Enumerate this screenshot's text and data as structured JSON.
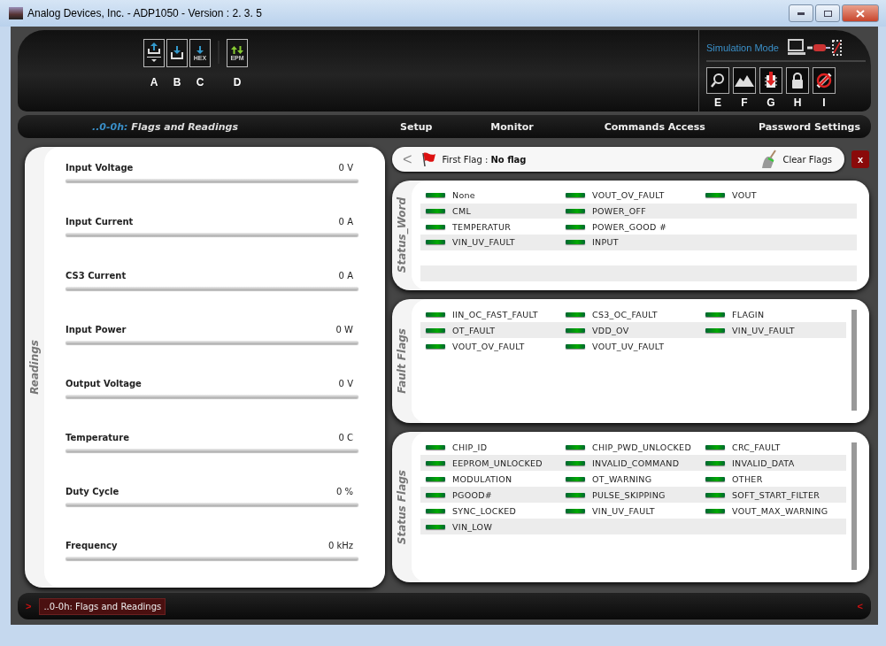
{
  "window": {
    "title": "Analog Devices, Inc. - ADP1050 - Version :  2. 3. 5"
  },
  "toolbar": [
    {
      "kind": "upload-menu",
      "letter": "A"
    },
    {
      "kind": "download",
      "letter": "B"
    },
    {
      "kind": "hex",
      "text": "HEX",
      "letter": "C"
    },
    {
      "kind": "epm",
      "text": "EPM",
      "letter": "D"
    }
  ],
  "mode": {
    "label": "Simulation Mode"
  },
  "tools": [
    {
      "kind": "search",
      "letter": "E"
    },
    {
      "kind": "chart",
      "letter": "F"
    },
    {
      "kind": "chip-download",
      "letter": "G"
    },
    {
      "kind": "lock",
      "letter": "H"
    },
    {
      "kind": "disconnect",
      "letter": "I"
    }
  ],
  "breadcrumb": {
    "prefix": "..0-0h:",
    "title": "Flags and Readings"
  },
  "tabs": [
    {
      "label": "Setup",
      "selected": false
    },
    {
      "label": "Monitor",
      "selected": false
    },
    {
      "label": "Commands Access",
      "selected": false
    },
    {
      "label": "Password Settings",
      "selected": false
    }
  ],
  "readings": {
    "title": "Readings",
    "items": [
      {
        "name": "Input Voltage",
        "reading": "0 V",
        "level": 0
      },
      {
        "name": "Input Current",
        "reading": "0 A",
        "level": 0
      },
      {
        "name": "CS3 Current",
        "reading": "0 A",
        "level": 0
      },
      {
        "name": "Input Power",
        "reading": "0 W",
        "level": 0
      },
      {
        "name": "Output Voltage",
        "reading": "0 V",
        "level": 0
      },
      {
        "name": "Temperature",
        "reading": "0 C",
        "level": 0
      },
      {
        "name": "Duty Cycle",
        "reading": "0 %",
        "level": 0
      },
      {
        "name": "Frequency",
        "reading": "0 kHz",
        "level": 0
      }
    ]
  },
  "first_flag": {
    "back": "<",
    "label": "First Flag :",
    "value": "No flag",
    "clear": "Clear Flags",
    "close": "x"
  },
  "panels": [
    {
      "title": "Status_Word",
      "scroll": false,
      "rows": [
        [
          {
            "name": "None",
            "on": false
          },
          {
            "name": "VOUT_OV_FAULT",
            "on": false
          },
          {
            "name": "VOUT",
            "on": false
          }
        ],
        [
          {
            "name": "CML",
            "on": false
          },
          {
            "name": "POWER_OFF",
            "on": false
          }
        ],
        [
          {
            "name": "TEMPERATUR",
            "on": false
          },
          {
            "name": "POWER_GOOD #",
            "on": false
          }
        ],
        [
          {
            "name": "VIN_UV_FAULT",
            "on": false
          },
          {
            "name": "INPUT",
            "on": false
          }
        ]
      ]
    },
    {
      "title": "Fault Flags",
      "scroll": true,
      "rows": [
        [
          {
            "name": "IIN_OC_FAST_FAULT",
            "on": false
          },
          {
            "name": "CS3_OC_FAULT",
            "on": false
          },
          {
            "name": "FLAGIN",
            "on": false
          }
        ],
        [
          {
            "name": "OT_FAULT",
            "on": false
          },
          {
            "name": "VDD_OV",
            "on": false
          },
          {
            "name": "VIN_UV_FAULT",
            "on": false
          }
        ],
        [
          {
            "name": "VOUT_OV_FAULT",
            "on": false
          },
          {
            "name": "VOUT_UV_FAULT",
            "on": false
          }
        ]
      ]
    },
    {
      "title": "Status Flags",
      "scroll": true,
      "rows": [
        [
          {
            "name": "CHIP_ID",
            "on": false
          },
          {
            "name": "CHIP_PWD_UNLOCKED",
            "on": false
          },
          {
            "name": "CRC_FAULT",
            "on": false
          }
        ],
        [
          {
            "name": "EEPROM_UNLOCKED",
            "on": false
          },
          {
            "name": "INVALID_COMMAND",
            "on": false
          },
          {
            "name": "INVALID_DATA",
            "on": false
          }
        ],
        [
          {
            "name": "MODULATION",
            "on": false
          },
          {
            "name": "OT_WARNING",
            "on": false
          },
          {
            "name": "OTHER",
            "on": false
          }
        ],
        [
          {
            "name": "PGOOD#",
            "on": false
          },
          {
            "name": "PULSE_SKIPPING",
            "on": false
          },
          {
            "name": "SOFT_START_FILTER",
            "on": false
          }
        ],
        [
          {
            "name": "SYNC_LOCKED",
            "on": false
          },
          {
            "name": "VIN_UV_FAULT",
            "on": false
          },
          {
            "name": "VOUT_MAX_WARNING",
            "on": false
          }
        ],
        [
          {
            "name": "VIN_LOW",
            "on": false
          }
        ]
      ]
    }
  ],
  "bottom_bar": {
    "left": ">",
    "tab": "..0-0h: Flags and Readings",
    "right": "<"
  }
}
